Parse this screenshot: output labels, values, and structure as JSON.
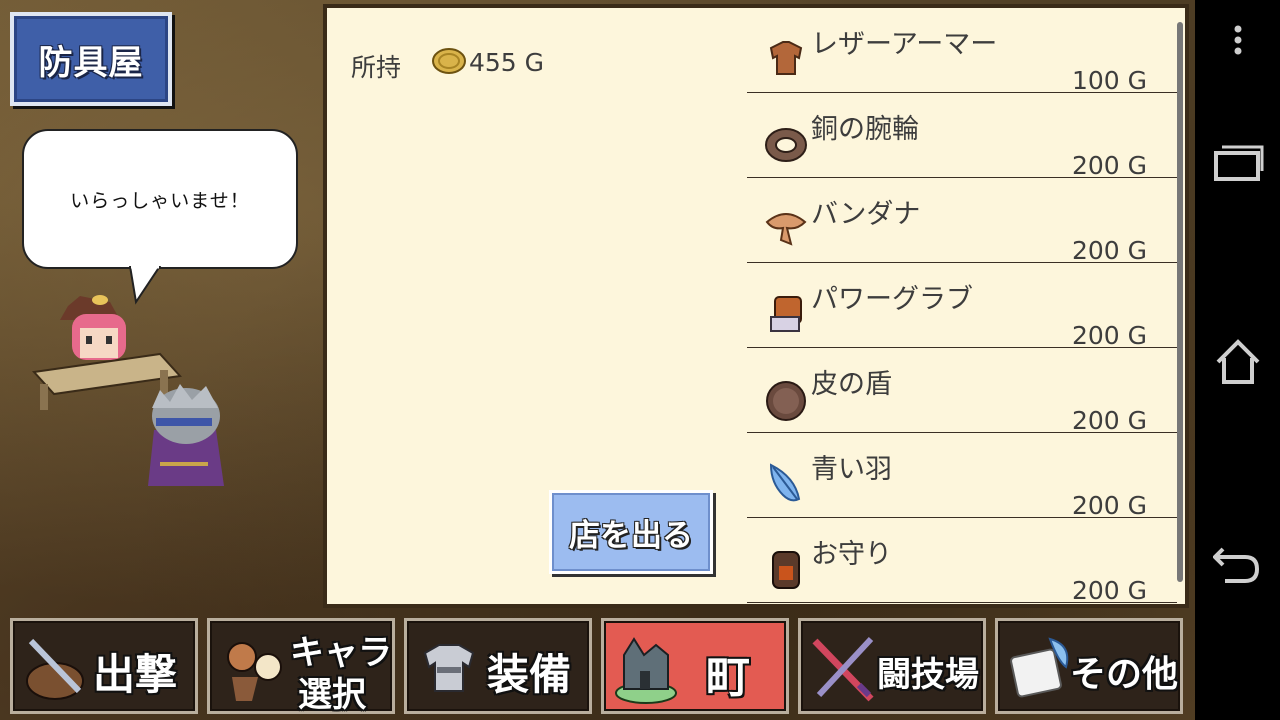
{
  "shop": {
    "title": "防具屋"
  },
  "speech": {
    "text": "いらっしゃいませ！"
  },
  "wallet": {
    "label": "所持",
    "amount": "455 G"
  },
  "exit_button": {
    "label": "店を出る"
  },
  "items": [
    {
      "name": "レザーアーマー",
      "price": "100 G",
      "icon": "leather-armor-icon"
    },
    {
      "name": "銅の腕輪",
      "price": "200 G",
      "icon": "copper-bracelet-icon"
    },
    {
      "name": "バンダナ",
      "price": "200 G",
      "icon": "bandana-icon"
    },
    {
      "name": "パワーグラブ",
      "price": "200 G",
      "icon": "power-glove-icon"
    },
    {
      "name": "皮の盾",
      "price": "200 G",
      "icon": "leather-shield-icon"
    },
    {
      "name": "青い羽",
      "price": "200 G",
      "icon": "blue-feather-icon"
    },
    {
      "name": "お守り",
      "price": "200 G",
      "icon": "amulet-icon"
    }
  ],
  "bottom_menu": {
    "sortie": "出撃",
    "char_select_line1": "キャラ",
    "char_select_line2": "選択",
    "equipment": "装備",
    "town": "町",
    "arena": "闘技場",
    "other": "その他"
  },
  "colors": {
    "panel_bg": "#fdf6dc",
    "title_bg": "#3f5fa8",
    "exit_button_bg": "#9cbcf0",
    "active_menu_bg": "#e35b52",
    "menu_bg": "#2e231a"
  }
}
